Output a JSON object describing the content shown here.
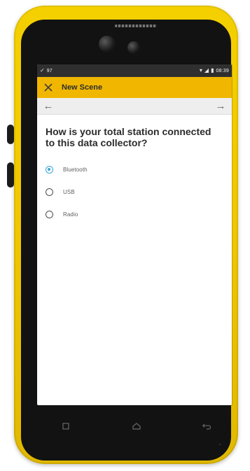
{
  "status_bar": {
    "left_text": "97",
    "right_text": "08:39"
  },
  "header": {
    "title": "New Scene"
  },
  "content": {
    "question": "How is your total station connected to this data collector?",
    "options": [
      {
        "label": "Bluetooth",
        "selected": true
      },
      {
        "label": "USB",
        "selected": false
      },
      {
        "label": "Radio",
        "selected": false
      }
    ]
  },
  "theme": {
    "accent": "#f0b600",
    "device_yellow": "#f1c800",
    "radio_selected": "#3aa6d7"
  },
  "icons": {
    "close": "close-icon",
    "back": "arrow-left-icon",
    "forward": "arrow-right-icon",
    "wifi": "wifi-icon",
    "signal": "signal-icon",
    "battery": "battery-icon",
    "apps": "recent-apps-icon",
    "home": "home-icon",
    "back_key": "back-icon"
  }
}
